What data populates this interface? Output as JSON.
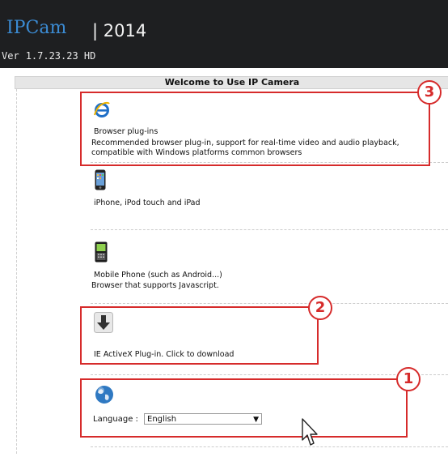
{
  "header": {
    "brand": "IPCam",
    "separator_year": "| 2014",
    "version_label": "Ver",
    "version_number": "1.7.23.23 HD"
  },
  "main": {
    "title": "Welcome to Use IP Camera",
    "items": [
      {
        "icon": "ie-browser-icon",
        "title": "Browser plug-ins",
        "description": "Recommended browser plug-in, support for real-time video and audio playback, compatible with Windows platforms common browsers"
      },
      {
        "icon": "iphone-icon",
        "title": "iPhone, iPod touch and iPad"
      },
      {
        "icon": "mobile-phone-icon",
        "title": "Mobile Phone (such as Android...)",
        "description": "Browser that supports Javascript."
      },
      {
        "icon": "download-arrow-icon",
        "title": "IE ActiveX Plug-in. Click to download"
      }
    ],
    "language": {
      "label": "Language :",
      "selected": "English"
    }
  },
  "annotations": {
    "labels": [
      "3",
      "2",
      "1"
    ],
    "color": "#d62b2b"
  },
  "colors": {
    "header_bg": "#1e1f21",
    "brand": "#3b8bd3",
    "titlebar_bg": "#e6e6e6"
  }
}
